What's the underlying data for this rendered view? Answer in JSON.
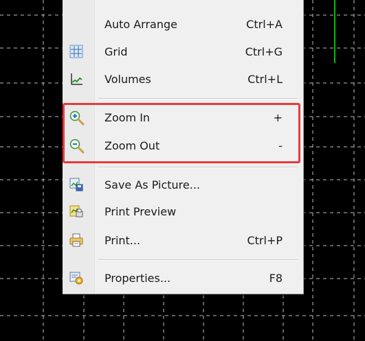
{
  "menu": {
    "items": [
      {
        "label": "Auto Arrange",
        "shortcut": "Ctrl+A",
        "icon": "none"
      },
      {
        "label": "Grid",
        "shortcut": "Ctrl+G",
        "icon": "grid-icon"
      },
      {
        "label": "Volumes",
        "shortcut": "Ctrl+L",
        "icon": "volumes-icon"
      },
      {
        "label": "Zoom In",
        "shortcut": "+",
        "icon": "zoom-in-icon"
      },
      {
        "label": "Zoom Out",
        "shortcut": "-",
        "icon": "zoom-out-icon"
      },
      {
        "label": "Save As Picture...",
        "shortcut": "",
        "icon": "save-picture-icon"
      },
      {
        "label": "Print Preview",
        "shortcut": "",
        "icon": "print-preview-icon"
      },
      {
        "label": "Print...",
        "shortcut": "Ctrl+P",
        "icon": "print-icon"
      },
      {
        "label": "Properties...",
        "shortcut": "F8",
        "icon": "properties-icon"
      }
    ]
  },
  "colors": {
    "chart_background": "#000000",
    "grid_lines": "#bfbfbf",
    "highlight_border": "#e53a3f",
    "price_line": "#00c000"
  }
}
